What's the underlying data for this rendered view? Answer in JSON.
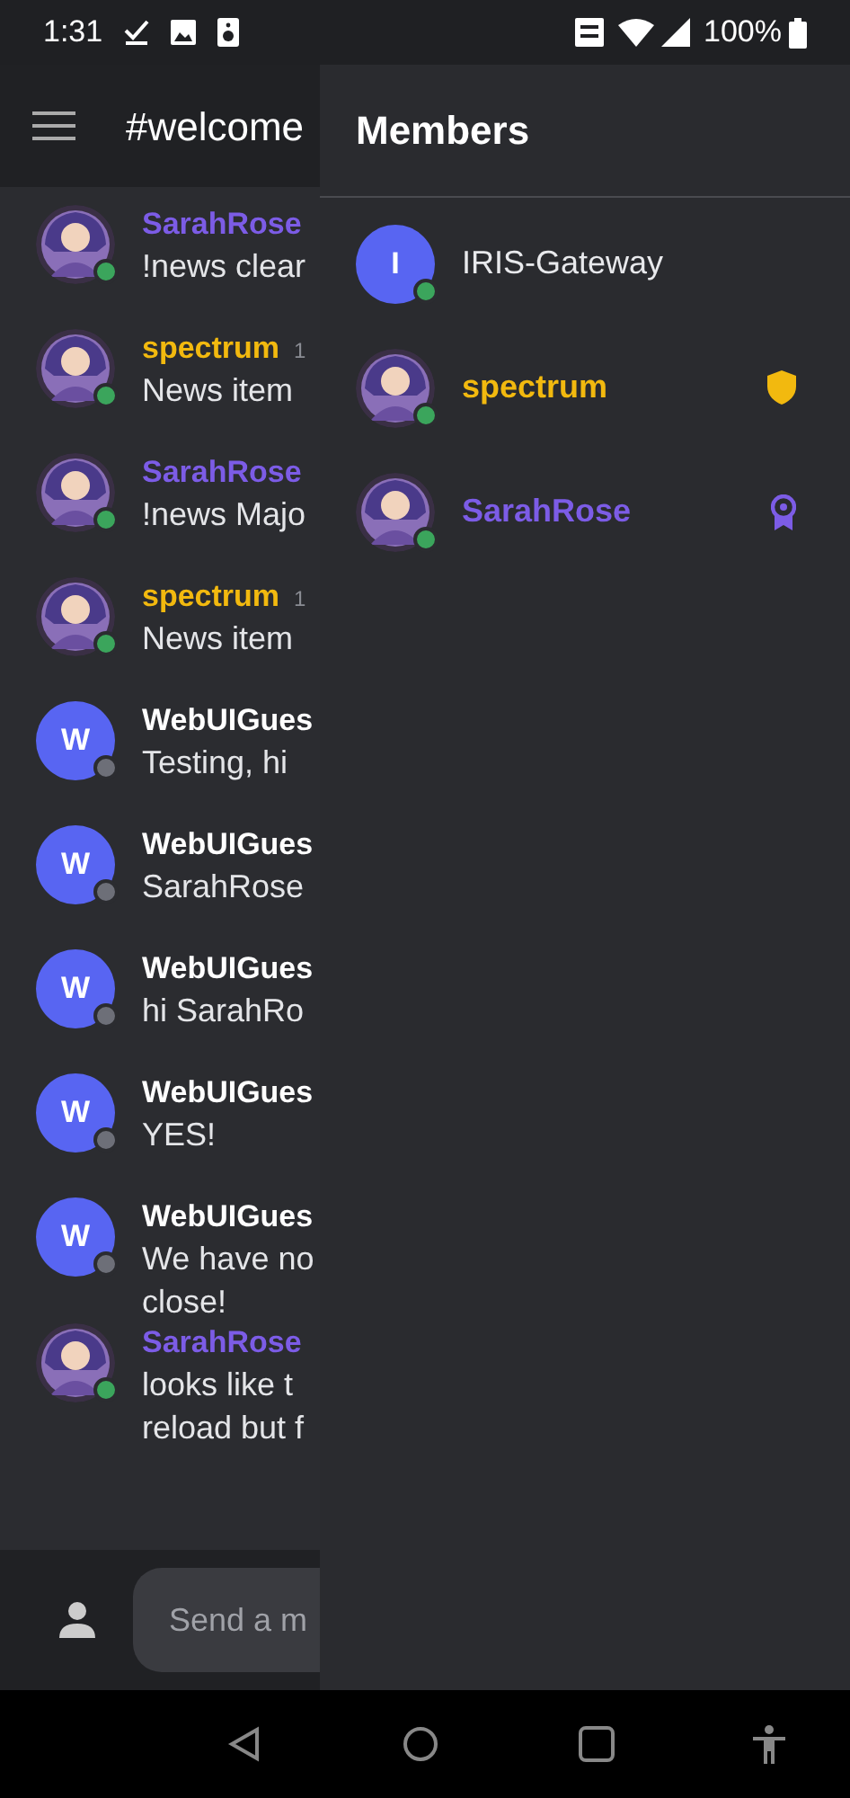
{
  "status_bar": {
    "time": "1:31",
    "battery": "100%"
  },
  "header": {
    "title": "#welcome"
  },
  "messages": [
    {
      "author": "SarahRose",
      "color": "#7c5ce6",
      "avatar": {
        "kind": "picture"
      },
      "online": true,
      "lines": [
        "!news clear"
      ]
    },
    {
      "author": "spectrum",
      "color": "#f2b90f",
      "time": "1",
      "avatar": {
        "kind": "picture"
      },
      "online": true,
      "lines": [
        "News item"
      ]
    },
    {
      "author": "SarahRose",
      "color": "#7c5ce6",
      "avatar": {
        "kind": "picture"
      },
      "online": true,
      "lines": [
        "!news Majo"
      ]
    },
    {
      "author": "spectrum",
      "color": "#f2b90f",
      "time": "1",
      "avatar": {
        "kind": "picture"
      },
      "online": true,
      "lines": [
        "News item"
      ]
    },
    {
      "author": "WebUIGues",
      "color": "#ffffff",
      "avatar": {
        "kind": "letter",
        "letter": "W"
      },
      "online": false,
      "lines": [
        "Testing, hi"
      ]
    },
    {
      "author": "WebUIGues",
      "color": "#ffffff",
      "avatar": {
        "kind": "letter",
        "letter": "W"
      },
      "online": false,
      "lines": [
        "SarahRose"
      ]
    },
    {
      "author": "WebUIGues",
      "color": "#ffffff",
      "avatar": {
        "kind": "letter",
        "letter": "W"
      },
      "online": false,
      "lines": [
        "hi SarahRo"
      ]
    },
    {
      "author": "WebUIGues",
      "color": "#ffffff",
      "avatar": {
        "kind": "letter",
        "letter": "W"
      },
      "online": false,
      "lines": [
        "YES!"
      ]
    },
    {
      "author": "WebUIGues",
      "color": "#ffffff",
      "avatar": {
        "kind": "letter",
        "letter": "W"
      },
      "online": false,
      "lines": [
        "We have no",
        "close!"
      ]
    },
    {
      "author": "SarahRose",
      "color": "#7c5ce6",
      "avatar": {
        "kind": "picture"
      },
      "online": true,
      "lines": [
        "looks like t",
        "reload but f"
      ]
    }
  ],
  "composer": {
    "placeholder": "Send a m"
  },
  "members_panel": {
    "title": "Members",
    "members": [
      {
        "name": "IRIS-Gateway",
        "avatar": {
          "kind": "letter",
          "letter": "I"
        },
        "online": true
      },
      {
        "name": "spectrum",
        "color": "#f2b90f",
        "avatar": {
          "kind": "picture"
        },
        "online": true,
        "kind": "moderator"
      },
      {
        "name": "SarahRose",
        "color": "#7c5ce6",
        "avatar": {
          "kind": "picture"
        },
        "online": true,
        "kind": "admin"
      }
    ]
  }
}
